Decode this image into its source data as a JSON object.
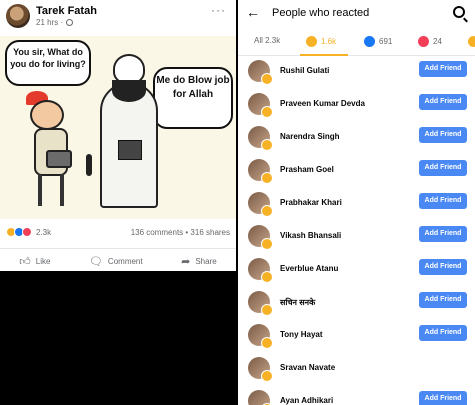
{
  "post": {
    "author": "Tarek Fatah",
    "time": "21 hrs · ",
    "more": "···",
    "cartoon": {
      "bubble_left": "You sir, What do you do for living?",
      "bubble_right": "Me do Blow job for Allah"
    },
    "reaction_count": "2.3k",
    "comments_shares": "136 comments • 316 shares",
    "actions": [
      {
        "label": "Like",
        "icon": "like-icon"
      },
      {
        "label": "Comment",
        "icon": "comment-icon"
      },
      {
        "label": "Share",
        "icon": "share-icon"
      }
    ]
  },
  "reactions": {
    "title": "People who reacted",
    "tabs": {
      "all": "All 2.3k",
      "haha": "1.6k",
      "like": "691",
      "love": "24"
    },
    "add_label": "Add Friend",
    "people": [
      {
        "name": "Rushil Gulati",
        "button": true
      },
      {
        "name": "Praveen Kumar Devda",
        "button": true
      },
      {
        "name": "Narendra Singh",
        "button": true
      },
      {
        "name": "Prasham Goel",
        "button": true
      },
      {
        "name": "Prabhakar Khari",
        "button": true
      },
      {
        "name": "Vikash Bhansali",
        "button": true
      },
      {
        "name": "Everblue Atanu",
        "button": true
      },
      {
        "name": "सचिन सनके",
        "button": true
      },
      {
        "name": "Tony Hayat",
        "button": true
      },
      {
        "name": "Sravan Navate",
        "button": false
      },
      {
        "name": "Ayan Adhikari",
        "button": true
      }
    ]
  }
}
